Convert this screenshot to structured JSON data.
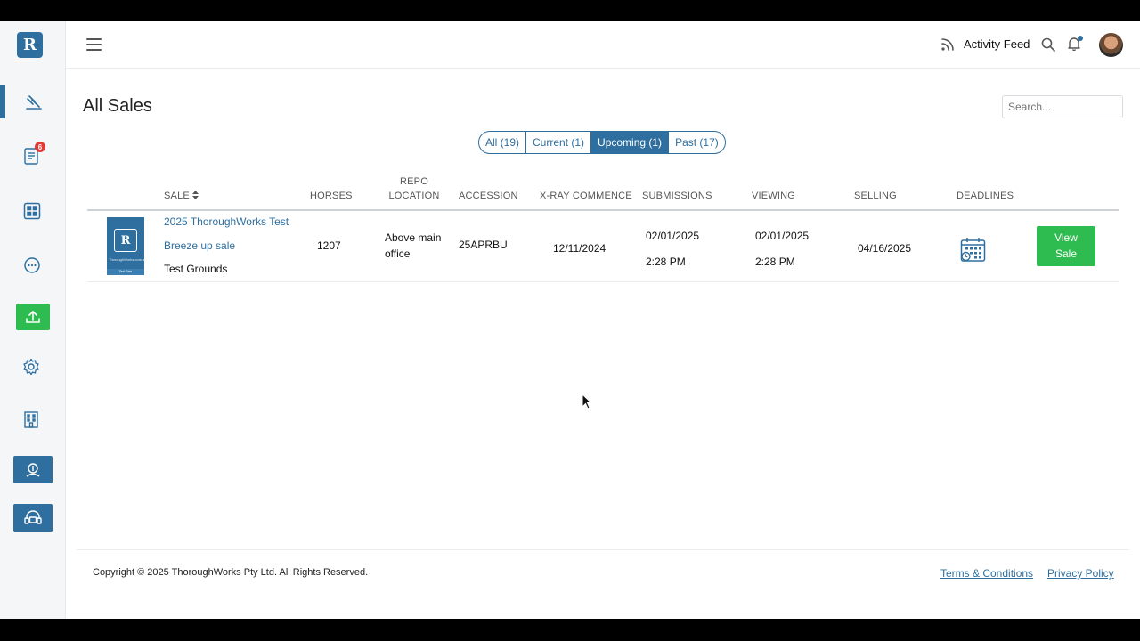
{
  "brand": {
    "logo_text": "R",
    "accent": "#2f6f9f",
    "success": "#2ebb4f"
  },
  "sidebar": {
    "items": [
      {
        "name": "gavel-icon",
        "active": true
      },
      {
        "name": "catalog-icon",
        "badge": "6"
      },
      {
        "name": "grid-icon"
      },
      {
        "name": "chat-icon"
      },
      {
        "name": "upload-icon"
      },
      {
        "name": "gear-icon"
      },
      {
        "name": "building-icon"
      },
      {
        "name": "money-icon"
      },
      {
        "name": "support-icon"
      }
    ]
  },
  "topbar": {
    "activity_feed_label": "Activity Feed"
  },
  "page": {
    "title": "All Sales",
    "search_placeholder": "Search..."
  },
  "filters": [
    {
      "label": "All (19)",
      "active": false
    },
    {
      "label": "Current (1)",
      "active": false
    },
    {
      "label": "Upcoming (1)",
      "active": true
    },
    {
      "label": "Past (17)",
      "active": false
    }
  ],
  "table": {
    "headers": {
      "sale": "SALE",
      "horses": "HORSES",
      "repo_location_1": "REPO",
      "repo_location_2": "LOCATION",
      "accession": "ACCESSION",
      "xray": "X-RAY COMMENCE",
      "submissions": "SUBMISSIONS",
      "viewing": "VIEWING",
      "selling": "SELLING",
      "deadlines": "DEADLINES"
    },
    "rows": [
      {
        "thumb_caption": "Test Sale",
        "thumb_small": "ThoroughWorks.com.au",
        "sale_name_1": "2025 ThoroughWorks Test",
        "sale_name_2": "Breeze up sale",
        "venue": "Test Grounds",
        "horses": "1207",
        "repo_location_1": "Above main",
        "repo_location_2": "office",
        "accession": "25APRBU",
        "xray": "12/11/2024",
        "submissions_date": "02/01/2025",
        "submissions_time": "2:28 PM",
        "viewing_date": "02/01/2025",
        "viewing_time": "2:28 PM",
        "selling": "04/16/2025",
        "view_label_1": "View",
        "view_label_2": "Sale"
      }
    ]
  },
  "footer": {
    "copyright": "Copyright © 2025 ThoroughWorks Pty Ltd. All Rights Reserved.",
    "terms": "Terms & Conditions",
    "privacy": "Privacy Policy"
  }
}
